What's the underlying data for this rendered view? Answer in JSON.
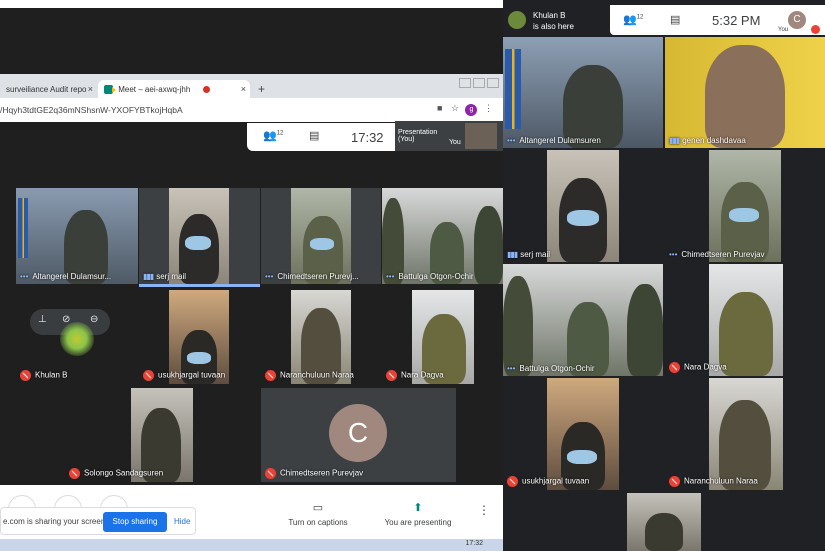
{
  "left": {
    "browser": {
      "tabs": [
        {
          "title": "surveiliance Audit repo",
          "close": "×"
        },
        {
          "title": "Meet – aei-axwq-jhh",
          "close": "×"
        }
      ],
      "new_tab": "+",
      "url": "/Hqyh3tdtGE2q36mNShsnW-YXOFYBTkojHqbA",
      "profile_initial": "g"
    },
    "meet_bar": {
      "participants_badge": "12",
      "time": "17:32",
      "presentation_label": "Presentation",
      "presentation_sub": "(You)",
      "you_label": "You"
    },
    "tiles": [
      {
        "name": "Altangerel Dulamsur...",
        "status": "dots"
      },
      {
        "name": "serj mail",
        "status": "speaking"
      },
      {
        "name": "Chimedtseren Purevj...",
        "status": "dots"
      },
      {
        "name": "Battulga Otgon-Ochir",
        "status": "dots"
      },
      {
        "name": "Khulan B",
        "status": "muted"
      },
      {
        "name": "usukhjargal tuvaan",
        "status": "muted"
      },
      {
        "name": "Naranchuluun Naraa",
        "status": "muted"
      },
      {
        "name": "Nara Dagva",
        "status": "muted"
      },
      {
        "name": "Solongo Sandagsuren",
        "status": "muted"
      },
      {
        "name": "Chimedtseren Purevjav",
        "status": "muted",
        "avatar_letter": "C"
      }
    ],
    "bottom_bar": {
      "captions_label": "Turn on captions",
      "presenting_label": "You are presenting",
      "share_notice": "e.com is sharing your screen.",
      "stop_sharing": "Stop sharing",
      "hide": "Hide"
    },
    "taskbar_clock": "17:32"
  },
  "right": {
    "notification": {
      "name": "Khulan B",
      "text": "is also here"
    },
    "meet_bar": {
      "participants_badge": "12",
      "time": "5:32 PM",
      "you_initial": "C",
      "you_label": "You"
    },
    "tiles": [
      {
        "name": "Altangerel Dulamsuren",
        "status": "dots"
      },
      {
        "name": "genen dashdavaa",
        "status": "speaking"
      },
      {
        "name": "serj mail",
        "status": "speaking"
      },
      {
        "name": "Chimedtseren Purevjav",
        "status": "dots"
      },
      {
        "name": "Battulga Otgon-Ochir",
        "status": "dots"
      },
      {
        "name": "Nara Dagva",
        "status": "muted"
      },
      {
        "name": "usukhjargal tuvaan",
        "status": "muted"
      },
      {
        "name": "Naranchuluun Naraa",
        "status": "muted"
      }
    ]
  }
}
